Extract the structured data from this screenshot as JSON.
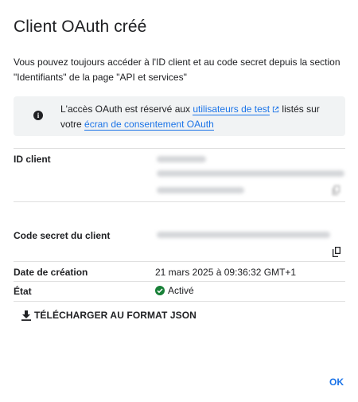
{
  "dialog": {
    "title": "Client OAuth créé",
    "intro": "Vous pouvez toujours accéder à l'ID client et au code secret depuis la section \"Identifiants\" de la page \"API et services\"",
    "info": {
      "icon": "info-icon",
      "text_before_link1": "L'accès OAuth est réservé aux ",
      "link1": "utilisateurs de test",
      "text_after_link1": " listés sur votre ",
      "link2": "écran de consentement OAuth"
    },
    "fields": {
      "client_id_label": "ID client",
      "client_secret_label": "Code secret du client",
      "creation_date_label": "Date de création",
      "creation_date_value": "21 mars 2025 à 09:36:32 GMT+1",
      "status_label": "État",
      "status_value": "Activé"
    },
    "download_label": "TÉLÉCHARGER AU FORMAT JSON",
    "ok_label": "OK"
  },
  "colors": {
    "accent": "#1a73e8",
    "success": "#188038",
    "info_bg": "#f1f3f4",
    "divider": "#e0e0e0"
  },
  "icons": [
    "info-icon",
    "external-link-icon",
    "copy-icon",
    "check-circle-icon",
    "download-icon"
  ]
}
